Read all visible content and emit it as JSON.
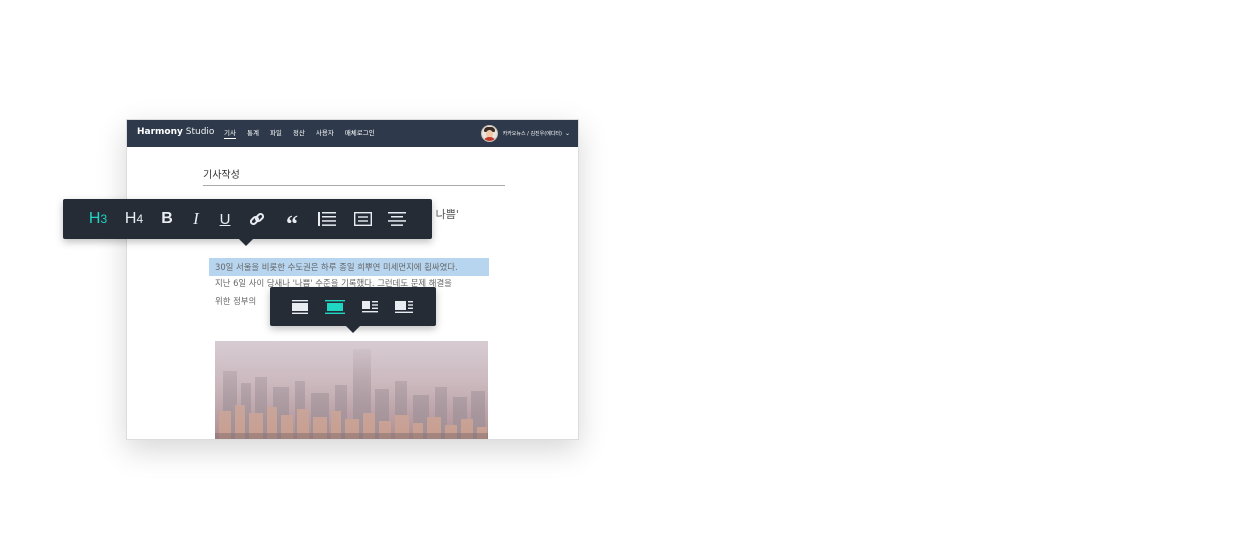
{
  "app": {
    "brand_bold": "Harmony",
    "brand_light": "Studio",
    "nav": [
      {
        "label": "기사",
        "active": true
      },
      {
        "label": "통계"
      },
      {
        "label": "파일"
      },
      {
        "label": "정산"
      },
      {
        "label": "사용자"
      },
      {
        "label": "매체로그인"
      }
    ],
    "user_label": "카카오뉴스 / 김진우(에디터)"
  },
  "editor": {
    "title": "기사작성",
    "heading_visible_tail": "우 나쁨'",
    "paragraph_lines": [
      "30일 서울을 비롯한 수도권은 하루 종일 희뿌연 미세먼지에 휩싸였다.",
      "지난 6일 사이 당새나 '나쁨' 수준을 기록했다. 그런데도 문제 해결을",
      "위한 정부의"
    ],
    "selection_color": "#b7d5ef"
  },
  "text_toolbar": {
    "items": [
      {
        "name": "h3-button",
        "label": "H",
        "sub": "3",
        "active": true
      },
      {
        "name": "h4-button",
        "label": "H",
        "sub": "4"
      },
      {
        "name": "bold-button",
        "label": "B"
      },
      {
        "name": "italic-button",
        "label": "I"
      },
      {
        "name": "underline-button",
        "label": "U"
      },
      {
        "name": "link-button",
        "icon": "link-icon"
      },
      {
        "name": "quote-button",
        "label": "“"
      },
      {
        "name": "blockquote-button",
        "icon": "blockquote-icon"
      },
      {
        "name": "box-button",
        "icon": "box-icon"
      },
      {
        "name": "align-center-button",
        "icon": "align-center-icon"
      }
    ],
    "active_color": "#1fd6c2"
  },
  "image_toolbar": {
    "items": [
      {
        "name": "image-full-button",
        "icon": "image-full-icon"
      },
      {
        "name": "image-center-button",
        "icon": "image-center-icon",
        "active": true
      },
      {
        "name": "image-left-button",
        "icon": "image-left-icon"
      },
      {
        "name": "image-right-button",
        "icon": "image-right-icon"
      }
    ]
  }
}
